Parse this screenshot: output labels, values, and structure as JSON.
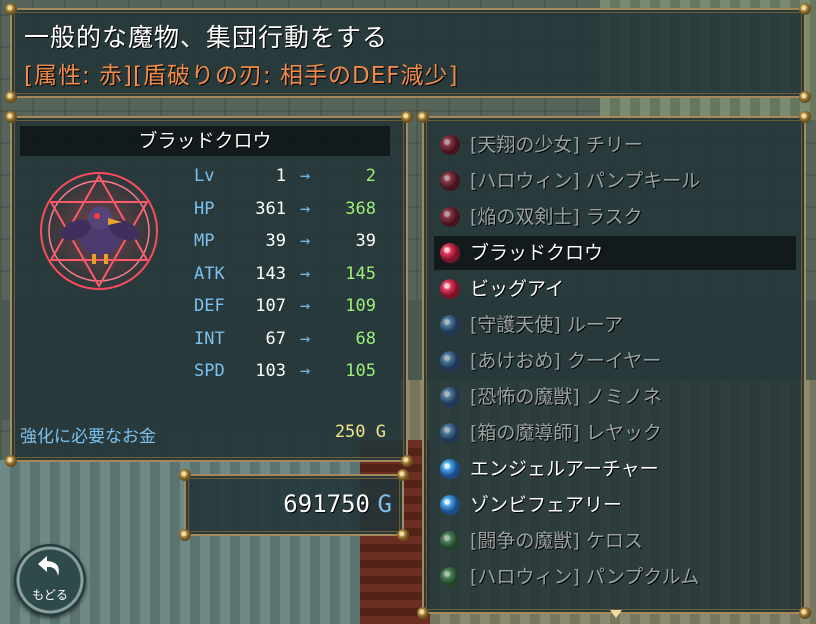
{
  "info": {
    "title": "一般的な魔物、集団行動をする",
    "subtitle": "[属性: 赤][盾破りの刃: 相手のDEF減少]"
  },
  "status": {
    "name": "ブラッドクロウ",
    "stats": [
      {
        "label": "Lv",
        "current": "1",
        "next": "2",
        "changed": true
      },
      {
        "label": "HP",
        "current": "361",
        "next": "368",
        "changed": true
      },
      {
        "label": "MP",
        "current": "39",
        "next": "39",
        "changed": false
      },
      {
        "label": "ATK",
        "current": "143",
        "next": "145",
        "changed": true
      },
      {
        "label": "DEF",
        "current": "107",
        "next": "109",
        "changed": true
      },
      {
        "label": "INT",
        "current": "67",
        "next": "68",
        "changed": true
      },
      {
        "label": "SPD",
        "current": "103",
        "next": "105",
        "changed": true
      }
    ],
    "arrow": "→",
    "cost_label": "強化に必要なお金",
    "cost_value": "250 G"
  },
  "gold": {
    "amount": "691750",
    "unit": "G"
  },
  "monster_list": [
    {
      "text": "[天翔の少女] チリー",
      "orb": "red",
      "dim": true,
      "selected": false
    },
    {
      "text": "[ハロウィン] パンプキール",
      "orb": "red",
      "dim": true,
      "selected": false
    },
    {
      "text": "[焔の双剣士] ラスク",
      "orb": "red",
      "dim": true,
      "selected": false
    },
    {
      "text": "ブラッドクロウ",
      "orb": "red",
      "dim": false,
      "selected": true
    },
    {
      "text": "ビッグアイ",
      "orb": "red",
      "dim": false,
      "selected": false
    },
    {
      "text": "[守護天使] ルーア",
      "orb": "blue",
      "dim": true,
      "selected": false
    },
    {
      "text": "[あけおめ] クーイヤー",
      "orb": "blue",
      "dim": true,
      "selected": false
    },
    {
      "text": "[恐怖の魔獣] ノミノネ",
      "orb": "blue",
      "dim": true,
      "selected": false
    },
    {
      "text": "[箱の魔導師] レヤック",
      "orb": "blue",
      "dim": true,
      "selected": false
    },
    {
      "text": "エンジェルアーチャー",
      "orb": "blue",
      "dim": false,
      "selected": false
    },
    {
      "text": "ゾンビフェアリー",
      "orb": "blue",
      "dim": false,
      "selected": false
    },
    {
      "text": "[闘争の魔獣] ケロス",
      "orb": "green",
      "dim": true,
      "selected": false
    },
    {
      "text": "[ハロウィン] パンプクルム",
      "orb": "green",
      "dim": true,
      "selected": false
    }
  ],
  "back_button": {
    "label": "もどる",
    "icon": "return-arrow-icon"
  },
  "colors": {
    "panel_border": "#a48a5a",
    "stat_label": "#7ec0ee",
    "stat_increase": "#9ef07a",
    "subtitle": "#f28a4a",
    "cost_value": "#f4e48a"
  }
}
